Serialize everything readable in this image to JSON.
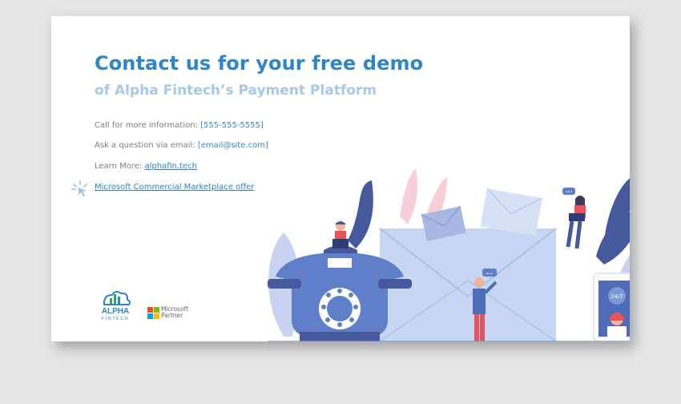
{
  "slide": {
    "title": "Contact us for your free demo",
    "subtitle": "of Alpha Fintech’s Payment Platform",
    "call_label": "Call for more information: ",
    "call_value": "[555-555-5555]",
    "email_label": "Ask a question via email: ",
    "email_value": "[email@site.com]",
    "learn_label": "Learn More: ",
    "learn_link": "alphafin.tech",
    "offer_link": "Microsoft Commercial Marketplace offer",
    "logo_line1": "ALPHA",
    "logo_line2": "FINTECH",
    "partner_line1": "Microsoft",
    "partner_line2": "Partner",
    "phone_badge": "24/7",
    "chat_dots": "•••"
  },
  "colors": {
    "title": "#2e86c9",
    "subtitle": "#a7c8e6",
    "link": "#2e7fc4",
    "background": "#e4e5e6"
  },
  "icons": [
    "cursor-click-icon",
    "alpha-fintech-logo",
    "microsoft-logo-icon"
  ]
}
